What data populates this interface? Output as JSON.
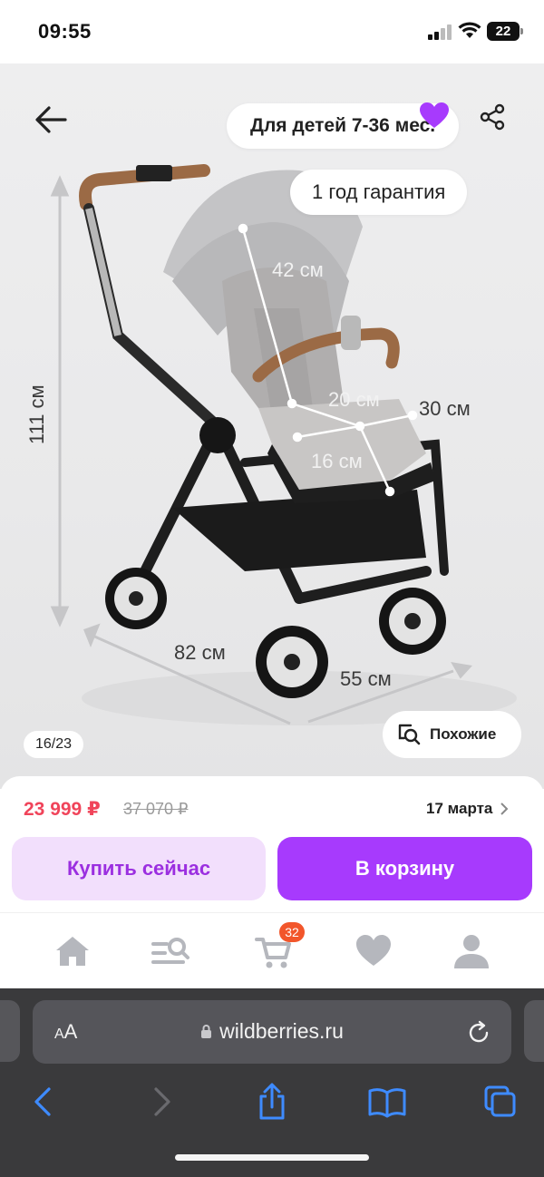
{
  "status_bar": {
    "time": "09:55",
    "battery": "22"
  },
  "hero": {
    "age_badge": "Для детей 7-36 мес.",
    "warranty_badge": "1 год гарантия",
    "image_counter": "16/23",
    "similar_label": "Похожие",
    "dimensions": {
      "height": "111 см",
      "back": "42 см",
      "seat_width": "20 см",
      "seat_depth_side": "30 см",
      "seat_depth": "16 см",
      "length": "82 см",
      "width": "55 см"
    }
  },
  "product": {
    "price": "23 999 ₽",
    "old_price": "37 070 ₽",
    "delivery": "17 марта",
    "buy_now_label": "Купить сейчас",
    "add_to_cart_label": "В корзину"
  },
  "tabbar": {
    "cart_count": "32"
  },
  "browser": {
    "text_size_label": "AA",
    "url": "wildberries.ru"
  },
  "colors": {
    "accent": "#a73afd",
    "price": "#f0445a",
    "badge": "#f2562b",
    "favorite": "#a73afd"
  },
  "icons": [
    "back-arrow-icon",
    "heart-icon",
    "share-icon",
    "similar-search-icon",
    "chevron-right-icon",
    "home-icon",
    "catalog-search-icon",
    "cart-icon",
    "favorites-icon",
    "profile-icon",
    "lock-icon",
    "reload-icon",
    "back-icon",
    "forward-icon",
    "share-sheet-icon",
    "bookmarks-icon",
    "tabs-icon"
  ]
}
